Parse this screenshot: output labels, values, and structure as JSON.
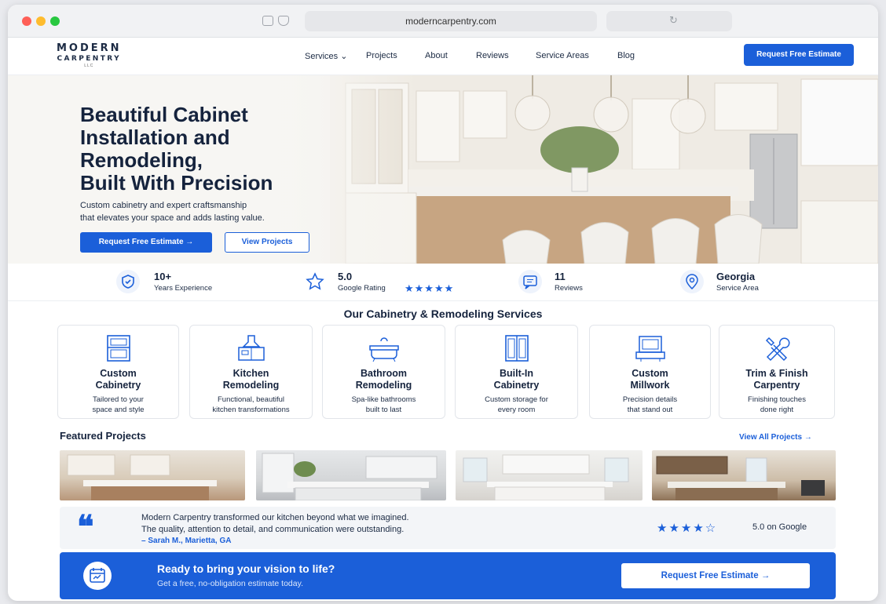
{
  "browser": {
    "url": "moderncarpentry.com"
  },
  "logo": {
    "line1": "MODERN",
    "line2": "CARPENTRY",
    "line3": "LLC"
  },
  "nav": {
    "items": [
      {
        "label": "Services ⌄"
      },
      {
        "label": "Projects"
      },
      {
        "label": "About"
      },
      {
        "label": "Reviews"
      },
      {
        "label": "Service Areas"
      },
      {
        "label": "Blog"
      }
    ],
    "cta": "Request Free Estimate"
  },
  "hero": {
    "title_lines": [
      "Beautiful Cabinet",
      "Installation and",
      "Remodeling,",
      "Built With Precision"
    ],
    "subtitle_lines": [
      "Custom cabinetry and expert craftsmanship",
      "that elevates your space and adds lasting value."
    ],
    "primary_cta": "Request Free Estimate  →",
    "secondary_cta": "View Projects"
  },
  "stats": [
    {
      "value": "10+",
      "label": "Years Experience",
      "icon": "shield-check-icon"
    },
    {
      "value": "5.0",
      "label": "Google Rating",
      "stars": "★★★★★",
      "icon": "star-icon"
    },
    {
      "value": "11",
      "label": "Reviews",
      "icon": "chat-icon"
    },
    {
      "value": "Georgia",
      "label": "Service Area",
      "icon": "location-pin-icon"
    }
  ],
  "services": {
    "title": "Our Cabinetry & Remodeling Services",
    "items": [
      {
        "title_lines": [
          "Custom",
          "Cabinetry"
        ],
        "desc_lines": [
          "Tailored to your",
          "space and style"
        ],
        "icon": "cabinet-icon"
      },
      {
        "title_lines": [
          "Kitchen",
          "Remodeling"
        ],
        "desc_lines": [
          "Functional, beautiful",
          "kitchen transformations"
        ],
        "icon": "kitchen-hood-icon"
      },
      {
        "title_lines": [
          "Bathroom",
          "Remodeling"
        ],
        "desc_lines": [
          "Spa-like bathrooms",
          "built to last"
        ],
        "icon": "bathtub-icon"
      },
      {
        "title_lines": [
          "Built-In",
          "Cabinetry"
        ],
        "desc_lines": [
          "Custom storage for",
          "every room"
        ],
        "icon": "built-in-cabinet-icon"
      },
      {
        "title_lines": [
          "Custom",
          "Millwork"
        ],
        "desc_lines": [
          "Precision details",
          "that stand out"
        ],
        "icon": "millwork-icon"
      },
      {
        "title_lines": [
          "Trim & Finish",
          "Carpentry"
        ],
        "desc_lines": [
          "Finishing touches",
          "done right"
        ],
        "icon": "tools-icon"
      }
    ]
  },
  "featured": {
    "title": "Featured Projects",
    "link": "View All Projects  →"
  },
  "testimonial": {
    "quote_lines": [
      "Modern Carpentry transformed our kitchen beyond what we imagined.",
      "The quality, attention to detail, and communication were outstanding."
    ],
    "author": "– Sarah M., Marietta, GA",
    "stars": "★★★★☆",
    "rating": "5.0 on Google"
  },
  "cta_banner": {
    "title": "Ready to bring your vision to life?",
    "subtitle": "Get a free, no-obligation estimate today.",
    "button": "Request Free Estimate  →"
  },
  "colors": {
    "accent": "#1b5fd9",
    "navy": "#15233d",
    "page_bg": "#ffffff"
  }
}
